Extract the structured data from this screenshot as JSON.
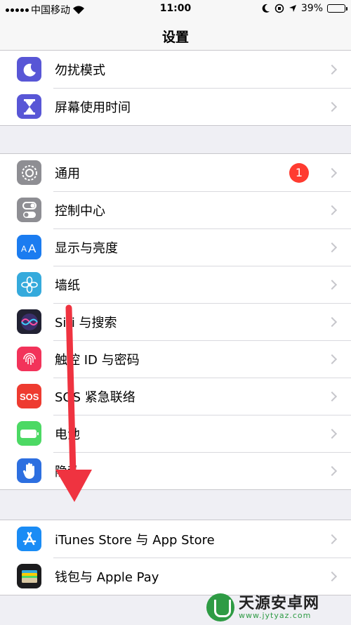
{
  "status_bar": {
    "carrier": "中国移动",
    "time": "11:00",
    "battery_percent": "39%",
    "battery_level": 0.39,
    "icons": [
      "signal-icon",
      "wifi-icon",
      "moon-icon",
      "rotation-lock-icon",
      "location-icon",
      "battery-icon"
    ]
  },
  "nav": {
    "title": "设置"
  },
  "groups": [
    {
      "rows": [
        {
          "label": "勿扰模式",
          "icon": "moon-icon",
          "color": "#5856d6"
        },
        {
          "label": "屏幕使用时间",
          "icon": "hourglass-icon",
          "color": "#5856d6"
        }
      ]
    },
    {
      "rows": [
        {
          "label": "通用",
          "icon": "gear-icon",
          "color": "#8e8e93",
          "badge": "1"
        },
        {
          "label": "控制中心",
          "icon": "toggle-icon",
          "color": "#8e8e93"
        },
        {
          "label": "显示与亮度",
          "icon": "text-size-icon",
          "color": "#1b7cf0"
        },
        {
          "label": "墙纸",
          "icon": "flower-icon",
          "color": "#35aadc"
        },
        {
          "label": "Siri 与搜索",
          "icon": "siri-icon",
          "color": "#222233"
        },
        {
          "label": "触控 ID 与密码",
          "icon": "fingerprint-icon",
          "color": "#f2335a"
        },
        {
          "label": "SOS 紧急联络",
          "icon": "sos-icon",
          "color": "#ee3b30"
        },
        {
          "label": "电池",
          "icon": "battery-icon",
          "color": "#4cd964"
        },
        {
          "label": "隐私",
          "icon": "hand-icon",
          "color": "#2d6fe0"
        }
      ]
    },
    {
      "rows": [
        {
          "label": "iTunes Store 与 App Store",
          "icon": "app-store-icon",
          "color": "#1a8cf5"
        },
        {
          "label": "钱包与 Apple Pay",
          "icon": "wallet-icon",
          "color": "#1c1c1e"
        }
      ]
    }
  ],
  "colors": {
    "badge": "#ff3b30",
    "arrow": "#ef3340",
    "battery_fill": "#4cd964"
  },
  "watermark": {
    "name": "天源安卓网",
    "url": "www.jytyaz.com"
  }
}
